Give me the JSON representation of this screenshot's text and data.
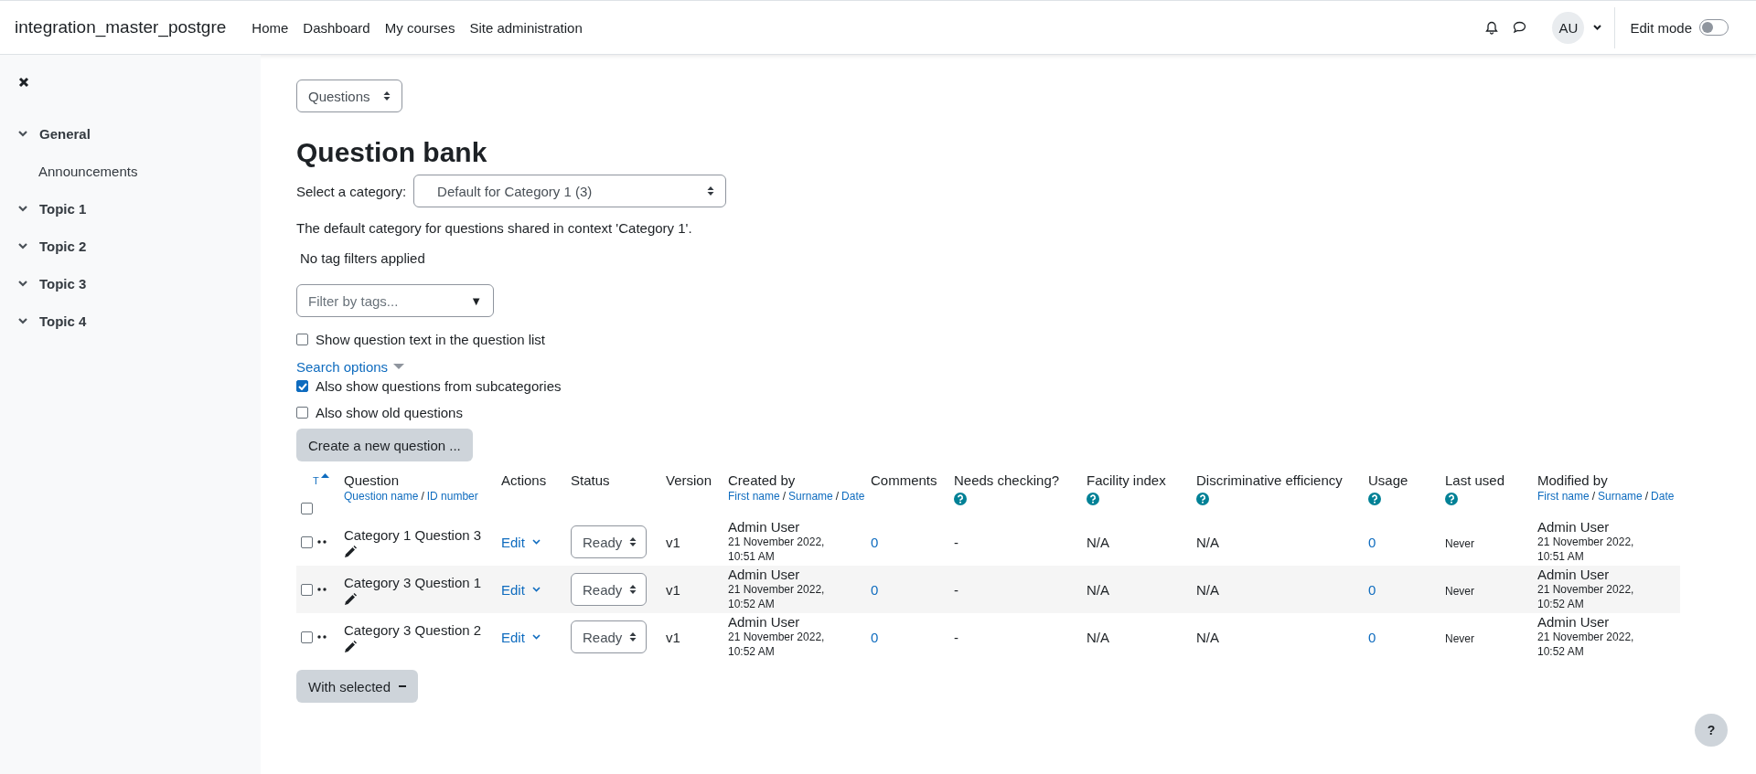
{
  "site_name": "integration_master_postgre",
  "nav": [
    {
      "label": "Home"
    },
    {
      "label": "Dashboard"
    },
    {
      "label": "My courses"
    },
    {
      "label": "Site administration"
    }
  ],
  "user_initials": "AU",
  "edit_mode": {
    "label": "Edit mode",
    "on": false
  },
  "sidebar": {
    "items": [
      {
        "label": "General",
        "expanded": true,
        "children": [
          {
            "label": "Announcements"
          }
        ]
      },
      {
        "label": "Topic 1",
        "expanded": true
      },
      {
        "label": "Topic 2",
        "expanded": true
      },
      {
        "label": "Topic 3",
        "expanded": true
      },
      {
        "label": "Topic 4",
        "expanded": true
      }
    ]
  },
  "page_select": "Questions",
  "title": "Question bank",
  "category": {
    "label": "Select a category:",
    "value": "Default for Category 1 (3)"
  },
  "category_info": "The default category for questions shared in context 'Category 1'.",
  "tag_filter_status": "No tag filters applied",
  "tag_filter": {
    "placeholder": "Filter by tags...",
    "glyph": "▼"
  },
  "options": [
    {
      "label": "Show question text in the question list",
      "checked": false
    }
  ],
  "search_options": "Search options",
  "search_option_list": [
    {
      "label": "Also show questions from subcategories",
      "checked": true
    },
    {
      "label": "Also show old questions",
      "checked": false
    }
  ],
  "create_button": "Create a new question ...",
  "table": {
    "link_separator": "/",
    "select_all_checked": false,
    "columns": [
      {
        "label": "T",
        "sorted_ascending": true
      },
      {
        "label": "Question",
        "links": [
          "Question name",
          "ID number"
        ]
      },
      {
        "label": "Actions"
      },
      {
        "label": "Status"
      },
      {
        "label": "Version"
      },
      {
        "label": "Created by",
        "links": [
          "First name",
          "Surname",
          "Date"
        ]
      },
      {
        "label": "Comments"
      },
      {
        "label": "Needs checking?",
        "help": true
      },
      {
        "label": "Facility index",
        "help": true
      },
      {
        "label": "Discriminative efficiency",
        "help": true
      },
      {
        "label": "Usage",
        "help": true
      },
      {
        "label": "Last used",
        "help": true
      },
      {
        "label": "Modified by",
        "links": [
          "First name",
          "Surname",
          "Date"
        ]
      }
    ],
    "rows": [
      {
        "selected": false,
        "name": "Category 1 Question 3",
        "action": "Edit",
        "status": "Ready",
        "version": "v1",
        "created_by": "Admin User",
        "created_date": "21 November 2022, 10:51 AM",
        "comments": "0",
        "needs_checking": "-",
        "facility": "N/A",
        "discrimination": "N/A",
        "usage": "0",
        "last_used": "Never",
        "modified_by": "Admin User",
        "modified_date": "21 November 2022, 10:51 AM"
      },
      {
        "selected": false,
        "name": "Category 3 Question 1",
        "action": "Edit",
        "status": "Ready",
        "version": "v1",
        "created_by": "Admin User",
        "created_date": "21 November 2022, 10:52 AM",
        "comments": "0",
        "needs_checking": "-",
        "facility": "N/A",
        "discrimination": "N/A",
        "usage": "0",
        "last_used": "Never",
        "modified_by": "Admin User",
        "modified_date": "21 November 2022, 10:52 AM"
      },
      {
        "selected": false,
        "name": "Category 3 Question 2",
        "action": "Edit",
        "status": "Ready",
        "version": "v1",
        "created_by": "Admin User",
        "created_date": "21 November 2022, 10:52 AM",
        "comments": "0",
        "needs_checking": "-",
        "facility": "N/A",
        "discrimination": "N/A",
        "usage": "0",
        "last_used": "Never",
        "modified_by": "Admin User",
        "modified_date": "21 November 2022, 10:52 AM"
      }
    ]
  },
  "with_selected": "With selected",
  "help_button": "?"
}
